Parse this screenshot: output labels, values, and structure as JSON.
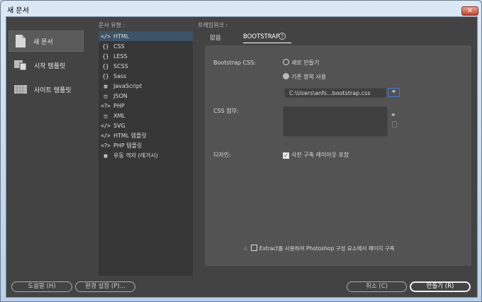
{
  "window": {
    "title": "새 문서",
    "close_icon": "✕"
  },
  "sidebar": {
    "items": [
      {
        "label": "새 문서",
        "icon": "new-document-icon"
      },
      {
        "label": "시작 템플릿",
        "icon": "starter-templates-icon"
      },
      {
        "label": "사이트 템플릿",
        "icon": "site-templates-icon"
      }
    ]
  },
  "doc_types": {
    "header": "문서 유형 :",
    "items": [
      {
        "icon": "</>",
        "label": "HTML"
      },
      {
        "icon": "{}",
        "label": "CSS"
      },
      {
        "icon": "{}",
        "label": "LESS"
      },
      {
        "icon": "{}",
        "label": "SCSS"
      },
      {
        "icon": "{}",
        "label": "Sass"
      },
      {
        "icon": "▨",
        "label": "JavaScript"
      },
      {
        "icon": "◫",
        "label": "JSON"
      },
      {
        "icon": "<?>",
        "label": "PHP"
      },
      {
        "icon": "◫",
        "label": "XML"
      },
      {
        "icon": "</>",
        "label": "SVG"
      },
      {
        "icon": "</>",
        "label": "HTML 템플릿"
      },
      {
        "icon": "<?>",
        "label": "PHP 템플릿"
      },
      {
        "icon": "▦",
        "label": "유동 격자 (레거시)"
      }
    ]
  },
  "framework": {
    "header": "프레임워크 :",
    "tabs": [
      "없음",
      "BOOTSTRAP"
    ],
    "help": "?",
    "bootstrap_css_label": "Bootstrap CSS:",
    "radio_new": "새로 만들기",
    "radio_existing": "기존 항목 사용",
    "css_path": "C:\\Users\\anfs...bootstrap.css",
    "attach_label": "CSS 첨부:",
    "design_label": "디자인:",
    "prebuilt_layout": "사전 구축 레이아웃 포함",
    "extract": "Extract를 사용하여 Photoshop 구성 요소에서 페이지 구축"
  },
  "buttons": {
    "help": "도움말 (H)",
    "prefs": "환경 설정 (P)...",
    "cancel": "취소 (C)",
    "create": "만들기 (R)"
  }
}
